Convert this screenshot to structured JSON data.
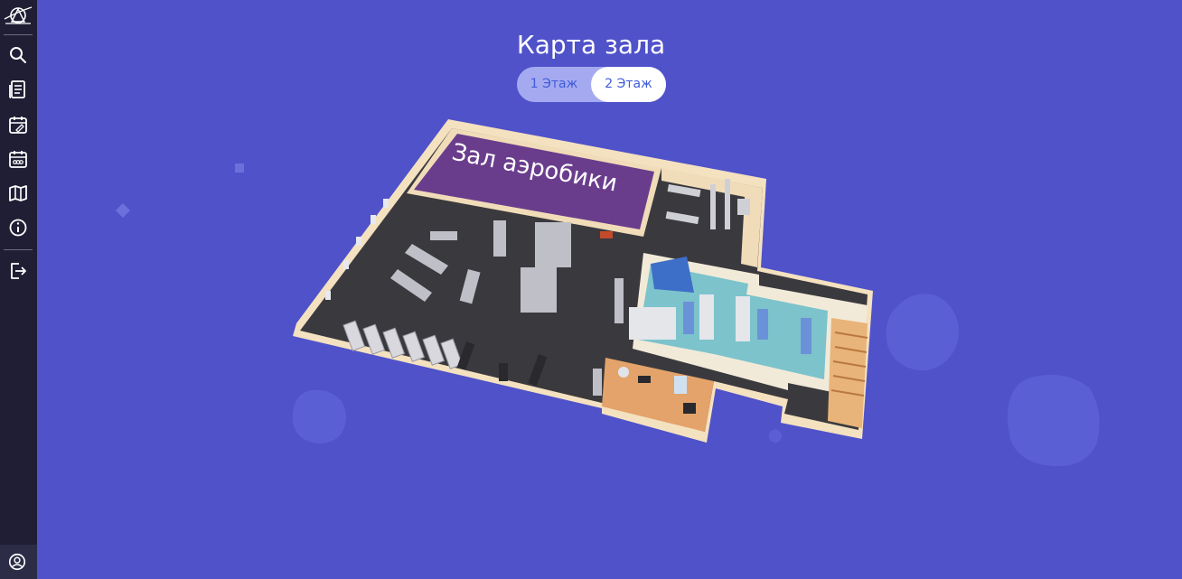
{
  "page": {
    "title": "Карта зала"
  },
  "floors": {
    "floor1_label": "1 Этаж",
    "floor2_label": "2 Этаж",
    "selected": "2 Этаж"
  },
  "map": {
    "zone_label": "Зал аэробики"
  },
  "sidebar": {
    "items": [
      {
        "icon": "search-icon"
      },
      {
        "icon": "document-list-icon"
      },
      {
        "icon": "calendar-edit-icon"
      },
      {
        "icon": "schedule-calendar-icon"
      },
      {
        "icon": "map-icon"
      },
      {
        "icon": "info-icon"
      },
      {
        "icon": "logout-icon"
      }
    ],
    "bottom": {
      "icon": "user-profile-icon"
    }
  },
  "colors": {
    "background": "#4f52c9",
    "sidebar": "#1f1e34",
    "toggle_active": "#ffffff",
    "toggle_inactive": "#a5aaf0",
    "accent_text": "#3f5bd9"
  }
}
